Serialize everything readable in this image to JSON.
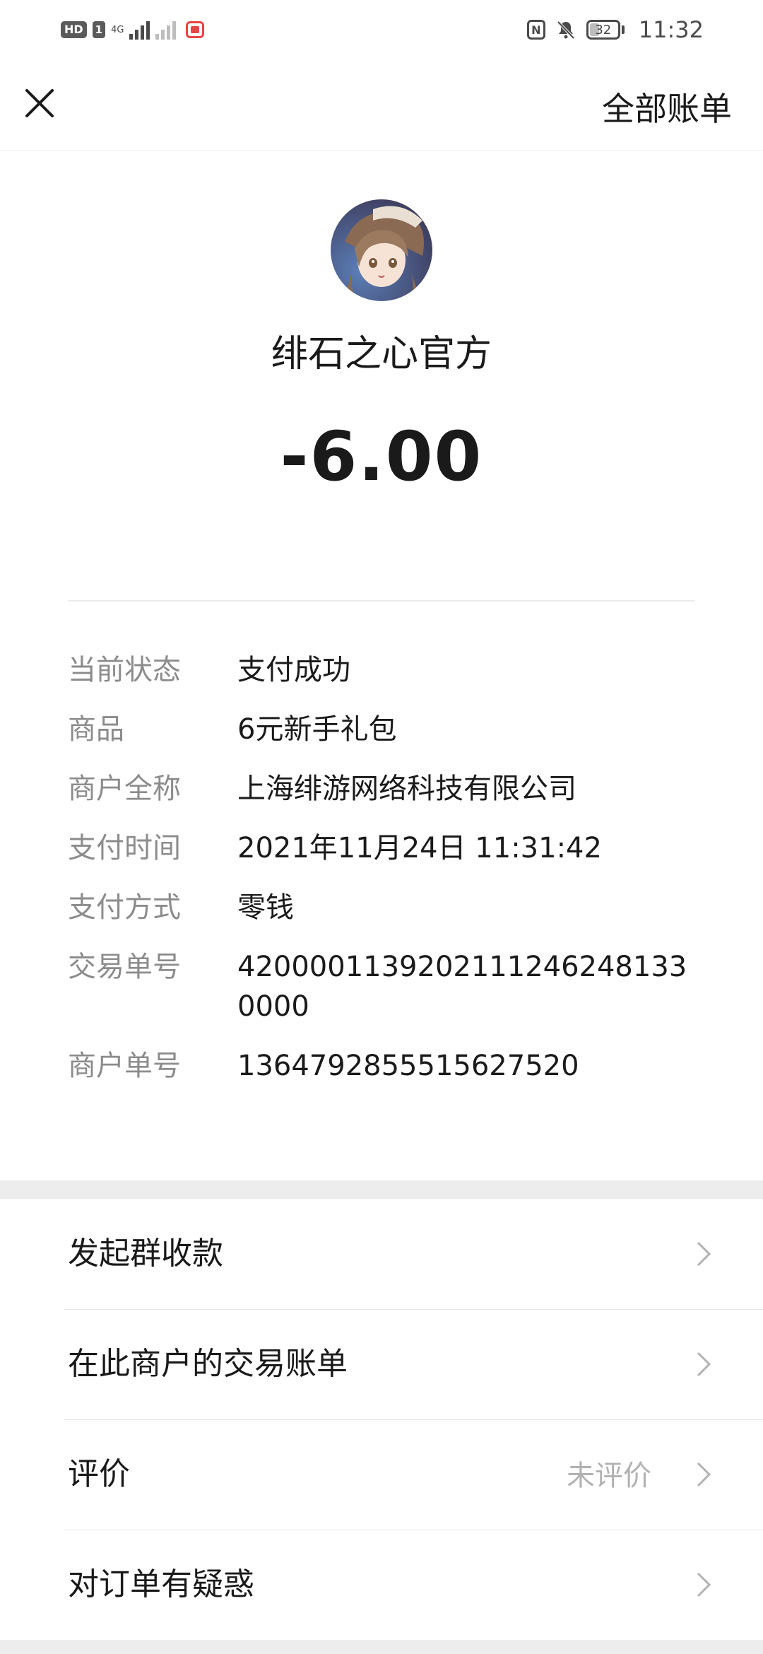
{
  "status_bar": {
    "hd": "HD",
    "sim": "1",
    "network": "4G",
    "time": "11:32",
    "battery": "32"
  },
  "nav": {
    "close_icon": "close-icon",
    "right_label": "全部账单"
  },
  "header": {
    "merchant_name": "绯石之心官方",
    "amount": "-6.00"
  },
  "details": [
    {
      "label": "当前状态",
      "value": "支付成功"
    },
    {
      "label": "商品",
      "value": "6元新手礼包"
    },
    {
      "label": "商户全称",
      "value": "上海绯游网络科技有限公司"
    },
    {
      "label": "支付时间",
      "value": "2021年11月24日 11:31:42"
    },
    {
      "label": "支付方式",
      "value": "零钱"
    },
    {
      "label": "交易单号",
      "value": "42000011392021112462481330000"
    },
    {
      "label": "商户单号",
      "value": "1364792855515627520"
    }
  ],
  "menu": [
    {
      "label": "发起群收款",
      "value": ""
    },
    {
      "label": "在此商户的交易账单",
      "value": ""
    },
    {
      "label": "评价",
      "value": "未评价"
    },
    {
      "label": "对订单有疑惑",
      "value": ""
    }
  ],
  "colors": {
    "background": "#ededed",
    "card": "#ffffff",
    "label_gray": "#8c8c8c",
    "text": "#1a1a1a"
  }
}
